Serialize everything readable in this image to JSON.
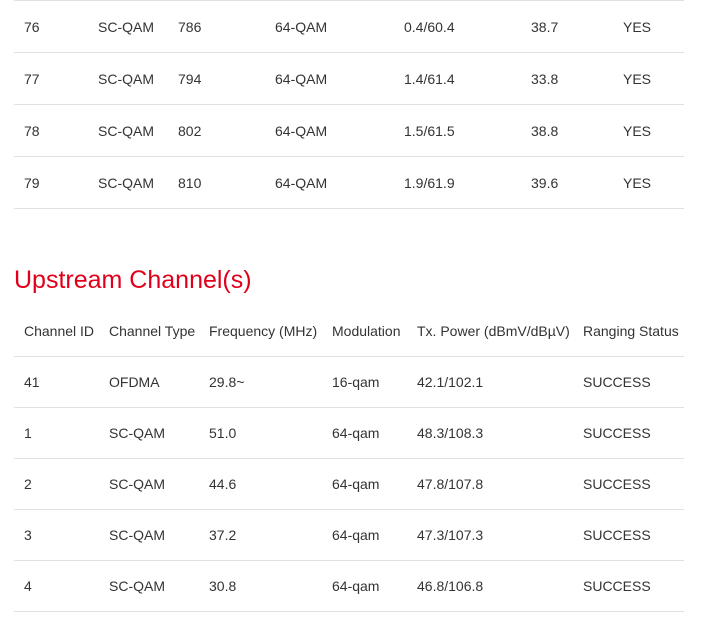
{
  "downstream": {
    "rows": [
      [
        "76",
        "SC-QAM",
        "786",
        "64-QAM",
        "0.4/60.4",
        "38.7",
        "YES"
      ],
      [
        "77",
        "SC-QAM",
        "794",
        "64-QAM",
        "1.4/61.4",
        "33.8",
        "YES"
      ],
      [
        "78",
        "SC-QAM",
        "802",
        "64-QAM",
        "1.5/61.5",
        "38.8",
        "YES"
      ],
      [
        "79",
        "SC-QAM",
        "810",
        "64-QAM",
        "1.9/61.9",
        "39.6",
        "YES"
      ]
    ]
  },
  "upstream": {
    "title": "Upstream Channel(s)",
    "headers": [
      "Channel ID",
      "Channel Type",
      "Frequency (MHz)",
      "Modulation",
      "Tx. Power (dBmV/dBµV)",
      "Ranging Status"
    ],
    "rows": [
      [
        "41",
        "OFDMA",
        "29.8~",
        "16-qam",
        "42.1/102.1",
        "SUCCESS"
      ],
      [
        "1",
        "SC-QAM",
        "51.0",
        "64-qam",
        "48.3/108.3",
        "SUCCESS"
      ],
      [
        "2",
        "SC-QAM",
        "44.6",
        "64-qam",
        "47.8/107.8",
        "SUCCESS"
      ],
      [
        "3",
        "SC-QAM",
        "37.2",
        "64-qam",
        "47.3/107.3",
        "SUCCESS"
      ],
      [
        "4",
        "SC-QAM",
        "30.8",
        "64-qam",
        "46.8/106.8",
        "SUCCESS"
      ]
    ]
  },
  "colors": {
    "section_title": "#e0001b",
    "text": "#333333",
    "divider": "#e1e1e1"
  }
}
